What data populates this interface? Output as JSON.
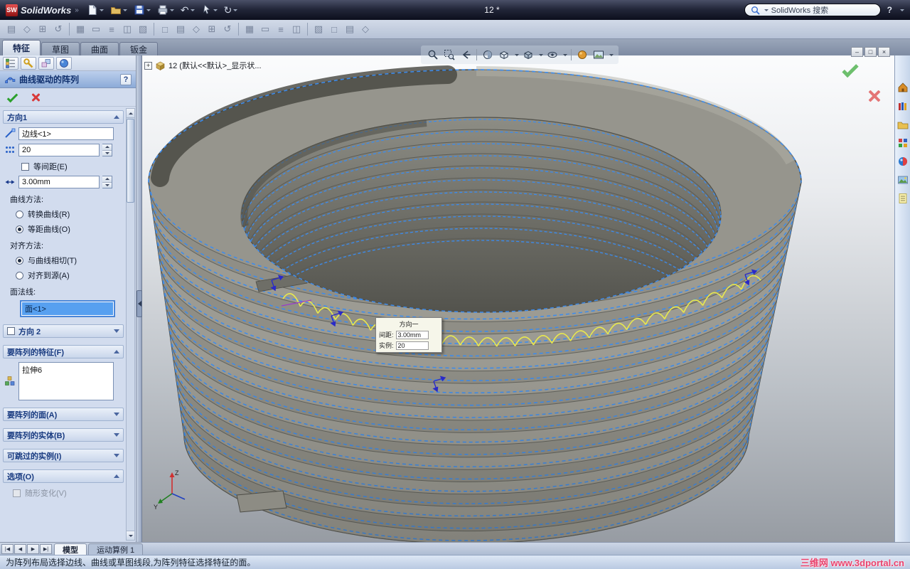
{
  "colors": {
    "highlight": "#3a8cf0",
    "preview": "#e9e94d",
    "selection_fill": "#57a0f0"
  },
  "titlebar": {
    "app_name": "SolidWorks",
    "doc_name": "12 *",
    "search_text": "SolidWorks 搜索",
    "help": "?"
  },
  "command_tabs": [
    "特征",
    "草图",
    "曲面",
    "钣金"
  ],
  "feature_tree": {
    "expand": "+",
    "root": "12 (默认<<默认>_显示状..."
  },
  "pm": {
    "title": "曲线驱动的阵列",
    "help": "?",
    "dir1": {
      "header": "方向1",
      "edge_value": "边线<1>",
      "instances": "20",
      "equal_spacing": "等间距(E)",
      "spacing": "3.00mm",
      "curve_method_label": "曲线方法:",
      "transform_curve": "转换曲线(R)",
      "offset_curve": "等距曲线(O)",
      "align_method_label": "对齐方法:",
      "tangent_to_curve": "与曲线相切(T)",
      "align_to_seed": "对齐到源(A)",
      "face_normal_label": "面法线:",
      "face_value": "面<1>"
    },
    "dir2": {
      "header": "方向 2"
    },
    "features": {
      "header": "要阵列的特征(F)",
      "item": "拉伸6"
    },
    "faces": {
      "header": "要阵列的面(A)"
    },
    "bodies": {
      "header": "要阵列的实体(B)"
    },
    "skip": {
      "header": "可跳过的实例(I)"
    },
    "options": {
      "header": "选项(O)",
      "vary_sketch": "随形变化(V)"
    }
  },
  "viewport": {
    "tooltip": {
      "title": "方向一",
      "spacing_label": "间距:",
      "spacing_value": "3.00mm",
      "instances_label": "实例:",
      "instances_value": "20"
    },
    "triad": {
      "z": "Z",
      "y": "Y"
    },
    "window_controls": {
      "minimize": "–",
      "restore": "□",
      "close": "×"
    }
  },
  "bottom_tabs": {
    "nav": [
      "|◀",
      "◀",
      "▶",
      "▶|"
    ],
    "model": "模型",
    "motion": "运动算例 1"
  },
  "statusbar": {
    "message": "为阵列布局选择边线、曲线或草图线段,为阵列特征选择特征的面。",
    "watermark": "三维网 www.3dportal.cn"
  }
}
